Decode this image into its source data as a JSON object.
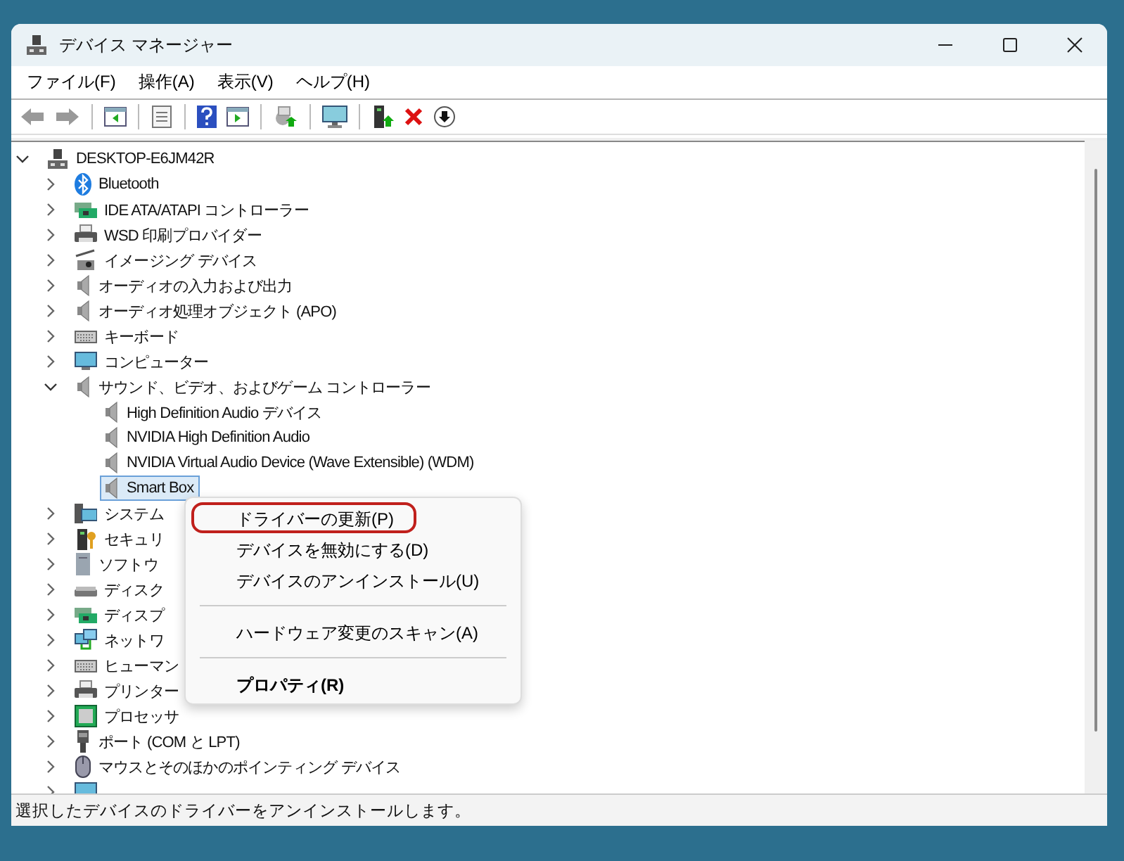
{
  "window": {
    "title": "デバイス マネージャー"
  },
  "menu_bar": [
    {
      "label": "ファイル(F)"
    },
    {
      "label": "操作(A)"
    },
    {
      "label": "表示(V)"
    },
    {
      "label": "ヘルプ(H)"
    }
  ],
  "tree": [
    {
      "label": "DESKTOP-E6JM42R",
      "kind": "computer",
      "expanded": true,
      "selected": false,
      "children": [
        {
          "label": "Bluetooth",
          "kind": "bluetooth",
          "expanded": false,
          "selected": false
        },
        {
          "label": "IDE ATA/ATAPI コントローラー",
          "kind": "card",
          "expanded": false,
          "selected": false
        },
        {
          "label": "WSD 印刷プロバイダー",
          "kind": "printer",
          "expanded": false,
          "selected": false
        },
        {
          "label": "イメージング デバイス",
          "kind": "camera",
          "expanded": false,
          "selected": false
        },
        {
          "label": "オーディオの入力および出力",
          "kind": "speaker",
          "expanded": false,
          "selected": false
        },
        {
          "label": "オーディオ処理オブジェクト (APO)",
          "kind": "speaker",
          "expanded": false,
          "selected": false
        },
        {
          "label": "キーボード",
          "kind": "keyboard",
          "expanded": false,
          "selected": false
        },
        {
          "label": "コンピューター",
          "kind": "monitor",
          "expanded": false,
          "selected": false
        },
        {
          "label": "サウンド、ビデオ、およびゲーム コントローラー",
          "kind": "speaker",
          "expanded": true,
          "selected": false,
          "children": [
            {
              "label": "High Definition Audio デバイス",
              "kind": "speaker",
              "selected": false
            },
            {
              "label": "NVIDIA High Definition Audio",
              "kind": "speaker",
              "selected": false
            },
            {
              "label": "NVIDIA Virtual Audio Device (Wave Extensible) (WDM)",
              "kind": "speaker",
              "selected": false
            },
            {
              "label": "Smart Box",
              "kind": "speaker",
              "selected": true
            }
          ]
        },
        {
          "label": "システム",
          "kind": "system",
          "expanded": false,
          "selected": false
        },
        {
          "label": "セキュリ",
          "kind": "security",
          "expanded": false,
          "selected": false
        },
        {
          "label": "ソフトウ",
          "kind": "tower",
          "expanded": false,
          "selected": false
        },
        {
          "label": "ディスク",
          "kind": "disk",
          "expanded": false,
          "selected": false
        },
        {
          "label": "ディスプ",
          "kind": "card",
          "expanded": false,
          "selected": false
        },
        {
          "label": "ネットワ",
          "kind": "network",
          "expanded": false,
          "selected": false
        },
        {
          "label": "ヒューマン",
          "kind": "keyboard",
          "expanded": false,
          "selected": false
        },
        {
          "label": "プリンター",
          "kind": "printer",
          "expanded": false,
          "selected": false
        },
        {
          "label": "プロセッサ",
          "kind": "chip",
          "expanded": false,
          "selected": false
        },
        {
          "label": "ポート (COM と LPT)",
          "kind": "port",
          "expanded": false,
          "selected": false
        },
        {
          "label": "マウスとそのほかのポインティング デバイス",
          "kind": "mouse",
          "expanded": false,
          "selected": false
        },
        {
          "kind": "monitor",
          "expanded": false,
          "selected": false
        }
      ]
    }
  ],
  "context_menu": [
    {
      "kind": "item",
      "label": "ドライバーの更新(P)",
      "circled": true,
      "default": false
    },
    {
      "kind": "item",
      "label": "デバイスを無効にする(D)",
      "circled": false,
      "default": false
    },
    {
      "kind": "item",
      "label": "デバイスのアンインストール(U)",
      "circled": false,
      "default": false
    },
    {
      "kind": "separator"
    },
    {
      "kind": "item",
      "label": "ハードウェア変更のスキャン(A)",
      "circled": false,
      "default": false
    },
    {
      "kind": "separator"
    },
    {
      "kind": "item",
      "label": "プロパティ(R)",
      "circled": false,
      "default": true
    }
  ],
  "status_bar": {
    "text": "選択したデバイスのドライバーをアンインストールします。"
  }
}
